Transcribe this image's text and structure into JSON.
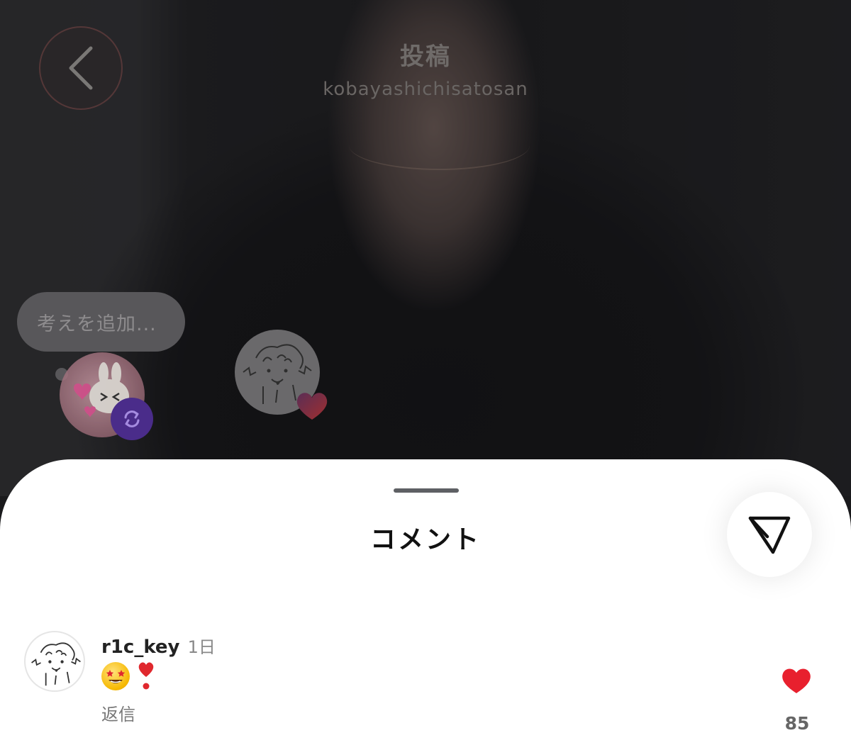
{
  "header": {
    "title": "投稿",
    "username": "kobayashichisatosan"
  },
  "thought": {
    "placeholder": "考えを追加..."
  },
  "comments_sheet": {
    "title": "コメント",
    "comments": [
      {
        "username": "r1c_key",
        "time": "1日",
        "text_emojis": [
          "star-struck-emoji",
          "red-exclamation-emoji"
        ],
        "reply_label": "返信",
        "like_count": "85",
        "liked": true
      }
    ]
  },
  "colors": {
    "like_red": "#e8202e",
    "repost_purple": "#4a2c8a",
    "sheet_bg": "#ffffff"
  }
}
